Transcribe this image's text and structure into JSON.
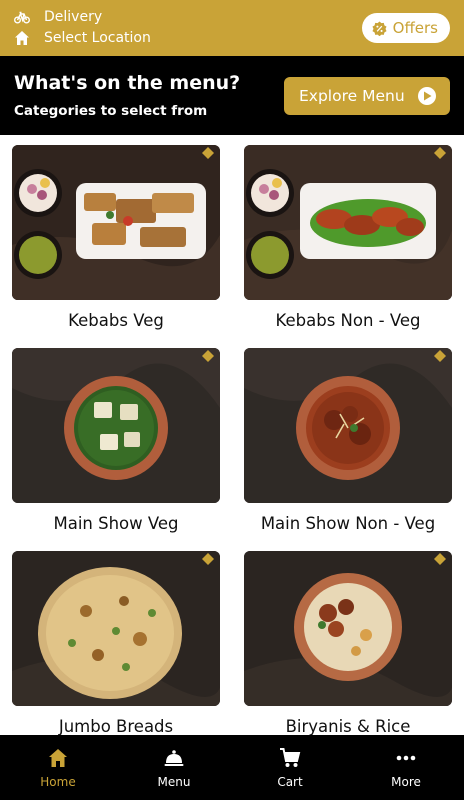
{
  "header": {
    "delivery_label": "Delivery",
    "location_label": "Select Location",
    "offers_label": "Offers",
    "icons": {
      "delivery": "bicycle-icon",
      "location": "home-icon",
      "offers": "badge-icon"
    }
  },
  "hero": {
    "title": "What's on the menu?",
    "subtitle": "Categories to select from",
    "explore_label": "Explore Menu"
  },
  "categories": [
    {
      "label": "Kebabs Veg"
    },
    {
      "label": "Kebabs Non - Veg"
    },
    {
      "label": "Main Show Veg"
    },
    {
      "label": "Main Show Non - Veg"
    },
    {
      "label": "Jumbo Breads"
    },
    {
      "label": "Biryanis & Rice"
    }
  ],
  "nav": [
    {
      "label": "Home",
      "icon": "home-icon"
    },
    {
      "label": "Menu",
      "icon": "cloche-icon"
    },
    {
      "label": "Cart",
      "icon": "cart-icon"
    },
    {
      "label": "More",
      "icon": "more-dots-icon"
    }
  ],
  "colors": {
    "accent": "#c9a337",
    "hero_bg": "#000000",
    "nav_bg": "#000000"
  }
}
